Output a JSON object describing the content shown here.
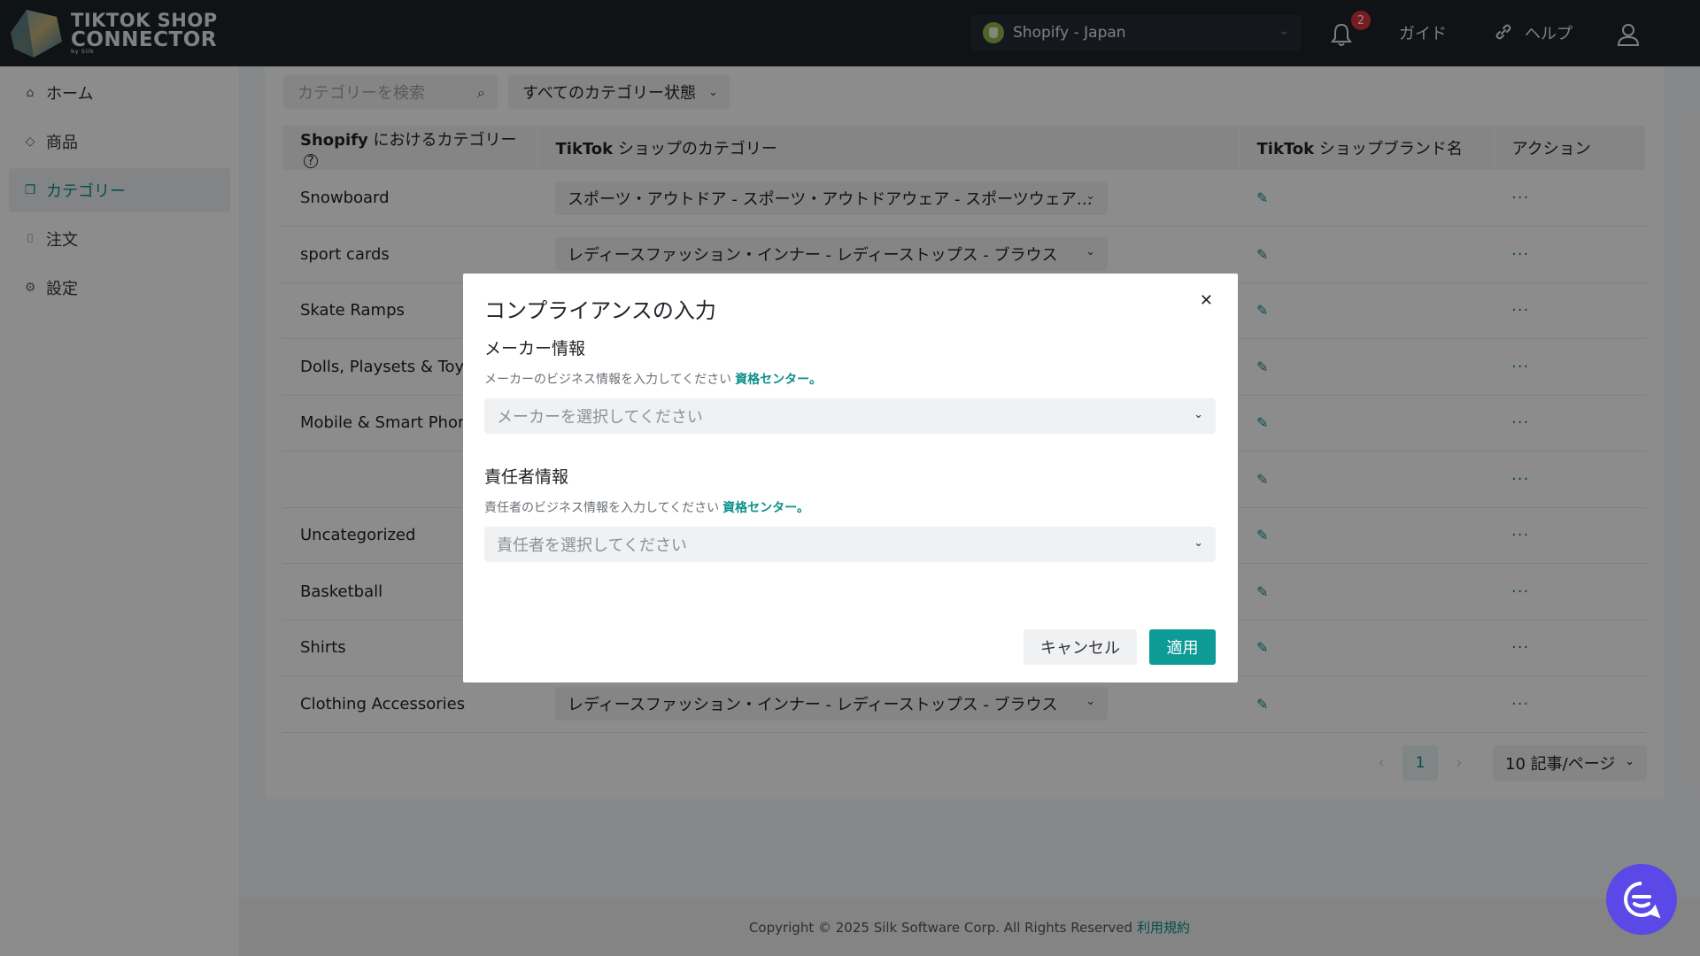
{
  "brand": {
    "line1": "TIKTOK SHOP",
    "line2": "CONNECTOR",
    "line3": "by Silk"
  },
  "topbar": {
    "store_label": "Shopify - Japan",
    "notification_count": "2",
    "guide_label": "ガイド",
    "help_label": "ヘルプ"
  },
  "sidebar": {
    "items": [
      {
        "label": "ホーム",
        "icon": "home-icon"
      },
      {
        "label": "商品",
        "icon": "tag-icon"
      },
      {
        "label": "カテゴリー",
        "icon": "category-icon",
        "active": true
      },
      {
        "label": "注文",
        "icon": "order-icon"
      },
      {
        "label": "設定",
        "icon": "gear-icon"
      }
    ]
  },
  "filters": {
    "search_placeholder": "カテゴリーを検索",
    "status_label": "すべてのカテゴリー状態"
  },
  "table": {
    "headers": {
      "shopify_bold": "Shopify",
      "shopify_rest": " におけるカテゴリー",
      "tiktok_bold": "TikTok",
      "tiktok_rest": " ショップのカテゴリー",
      "brand_bold": "TikTok",
      "brand_rest": " ショップブランド名",
      "action": "アクション"
    },
    "rows": [
      {
        "shopify": "Snowboard",
        "tiktok": "スポーツ・アウトドア - スポーツ・アウトドアウェア - スポーツウェア…"
      },
      {
        "shopify": "sport cards",
        "tiktok": "レディースファッション・インナー - レディーストップス - ブラウス"
      },
      {
        "shopify": "Skate Ramps",
        "tiktok": ""
      },
      {
        "shopify": "Dolls, Playsets & Toy Fig",
        "tiktok": ""
      },
      {
        "shopify": "Mobile & Smart Phones",
        "tiktok": ""
      },
      {
        "shopify": "",
        "tiktok": ""
      },
      {
        "shopify": "Uncategorized",
        "tiktok": ""
      },
      {
        "shopify": "Basketball",
        "tiktok": ""
      },
      {
        "shopify": "Shirts",
        "tiktok": ""
      },
      {
        "shopify": "Clothing Accessories",
        "tiktok": "レディースファッション・インナー - レディーストップス - ブラウス"
      }
    ]
  },
  "pagination": {
    "current": "1",
    "page_size": "10 記事/ページ"
  },
  "footer": {
    "copyright": "Copyright © 2025 Silk Software Corp. All Rights Reserved",
    "terms": "利用規約"
  },
  "modal": {
    "title": "コンプライアンスの入力",
    "maker_title": "メーカー情報",
    "maker_hint": "メーカーのビジネス情報を入力してください",
    "maker_link": "資格センター。",
    "maker_placeholder": "メーカーを選択してください",
    "responsible_title": "責任者情報",
    "responsible_hint": "責任者のビジネス情報を入力してください",
    "responsible_link": "資格センター。",
    "responsible_placeholder": "責任者を選択してください",
    "cancel_label": "キャンセル",
    "apply_label": "適用"
  },
  "colors": {
    "accent": "#0e8f8c",
    "topbar": "#1d2329",
    "chat": "#5a49e6",
    "badge": "#d9363e"
  }
}
